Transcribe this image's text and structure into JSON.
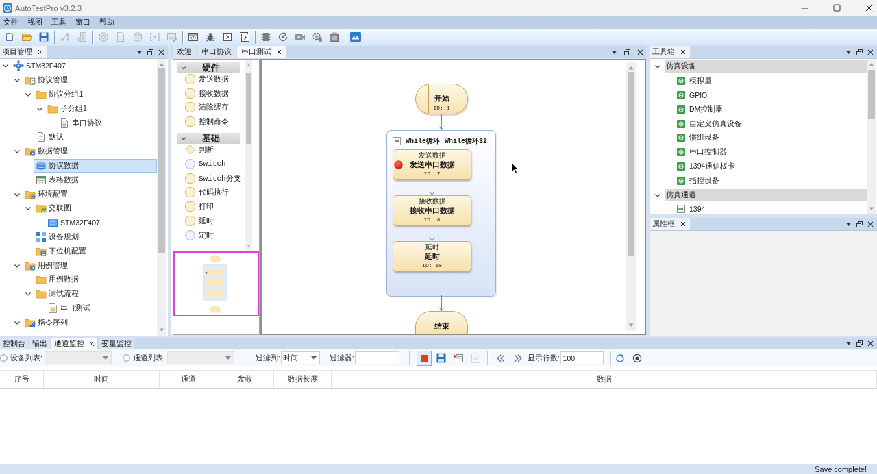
{
  "window": {
    "title": "AutoTestPro v3.2.3"
  },
  "menu": [
    "文件",
    "视图",
    "工具",
    "窗口",
    "帮助"
  ],
  "toolbar": [
    [
      {
        "disabled": false
      },
      {
        "disabled": false
      },
      {
        "disabled": false
      }
    ],
    [
      {
        "disabled": true
      },
      {
        "disabled": true
      }
    ],
    [
      {
        "disabled": true
      },
      {
        "disabled": true
      },
      {
        "disabled": true
      },
      {
        "disabled": true
      },
      {
        "disabled": true
      }
    ],
    [
      {
        "disabled": false
      },
      {
        "disabled": false
      },
      {
        "disabled": false
      },
      {
        "disabled": false
      }
    ],
    [
      {
        "disabled": false
      },
      {
        "disabled": false
      },
      {
        "disabled": false
      },
      {
        "disabled": false
      },
      {
        "disabled": false
      }
    ],
    [
      {
        "disabled": false
      }
    ]
  ],
  "project_panel": {
    "title": "项目管理",
    "tree": [
      {
        "label": "STM32F407",
        "kind": "project",
        "expanded": true,
        "selected": false,
        "children": [
          {
            "label": "协议管理",
            "kind": "group",
            "expanded": true,
            "selected": false,
            "children": [
              {
                "label": "协议分组1",
                "kind": "folder",
                "expanded": true,
                "selected": false,
                "children": [
                  {
                    "label": "子分组1",
                    "kind": "folder",
                    "expanded": true,
                    "selected": false,
                    "children": [
                      {
                        "label": "串口协议",
                        "kind": "file",
                        "selected": false
                      }
                    ]
                  }
                ]
              },
              {
                "label": "默认",
                "kind": "file",
                "selected": false
              }
            ]
          },
          {
            "label": "数据管理",
            "kind": "data",
            "expanded": true,
            "selected": false,
            "children": [
              {
                "label": "协议数据",
                "kind": "dataset",
                "selected": true
              },
              {
                "label": "表格数据",
                "kind": "table",
                "selected": false
              }
            ]
          },
          {
            "label": "环境配置",
            "kind": "config",
            "expanded": true,
            "selected": false,
            "children": [
              {
                "label": "交联图",
                "kind": "graph",
                "expanded": true,
                "selected": false,
                "children": [
                  {
                    "label": "STM32F407",
                    "kind": "board",
                    "selected": false
                  }
                ]
              },
              {
                "label": "设备规划",
                "kind": "layout",
                "selected": false
              },
              {
                "label": "下位机配置",
                "kind": "target",
                "selected": false
              }
            ]
          },
          {
            "label": "用例管理",
            "kind": "case",
            "expanded": true,
            "selected": false,
            "children": [
              {
                "label": "用例数据",
                "kind": "folder",
                "selected": false
              },
              {
                "label": "测试流程",
                "kind": "folder",
                "expanded": true,
                "selected": false,
                "children": [
                  {
                    "label": "串口测试",
                    "kind": "flow",
                    "selected": false
                  }
                ]
              }
            ]
          },
          {
            "label": "指令序列",
            "kind": "sequence",
            "expanded": true,
            "selected": false
          }
        ]
      }
    ]
  },
  "document": {
    "tabs": [
      {
        "label": "欢迎",
        "selected": false
      },
      {
        "label": "串口协议",
        "selected": false
      },
      {
        "label": "串口测试",
        "selected": true
      }
    ]
  },
  "palette": {
    "sections": [
      {
        "label": "硬件",
        "expanded": true,
        "items": [
          {
            "label": "发送数据",
            "kind": "task"
          },
          {
            "label": "接收数据",
            "kind": "task"
          },
          {
            "label": "清除缓存",
            "kind": "task"
          },
          {
            "label": "控制命令",
            "kind": "task"
          }
        ]
      },
      {
        "label": "基础",
        "expanded": true,
        "items": [
          {
            "label": "判断",
            "kind": "decision"
          },
          {
            "label": "Switch",
            "kind": "control"
          },
          {
            "label": "Switch分支",
            "kind": "task"
          },
          {
            "label": "代码执行",
            "kind": "task"
          },
          {
            "label": "打印",
            "kind": "task"
          },
          {
            "label": "延时",
            "kind": "task"
          },
          {
            "label": "定时",
            "kind": "control"
          }
        ]
      }
    ]
  },
  "flow": {
    "start": {
      "label": "开始",
      "id_label": "ID: 1"
    },
    "loop": {
      "type": "While循环",
      "name": "While循环32",
      "expanded": true,
      "steps": [
        {
          "category": "发送数据",
          "label": "发送串口数据",
          "id_label": "ID: 7",
          "breakpoint": true
        },
        {
          "category": "接收数据",
          "label": "接收串口数据",
          "id_label": "ID: 8",
          "breakpoint": false
        },
        {
          "category": "延时",
          "label": "延时",
          "id_label": "ID: 10",
          "breakpoint": false
        }
      ]
    },
    "end": {
      "label": "结束"
    }
  },
  "toolbox_panel": {
    "title": "工具箱",
    "groups": [
      {
        "label": "仿真设备",
        "expanded": true,
        "items": [
          {
            "label": "模拟量",
            "kind": "device"
          },
          {
            "label": "GPIO",
            "kind": "device"
          },
          {
            "label": "DM控制器",
            "kind": "device"
          },
          {
            "label": "自定义仿真设备",
            "kind": "device"
          },
          {
            "label": "惯组设备",
            "kind": "device"
          },
          {
            "label": "串口控制器",
            "kind": "device"
          },
          {
            "label": "1394通信板卡",
            "kind": "device"
          },
          {
            "label": "指控设备",
            "kind": "device"
          }
        ]
      },
      {
        "label": "仿真通道",
        "expanded": true,
        "items": [
          {
            "label": "1394",
            "kind": "channel"
          }
        ]
      }
    ]
  },
  "properties_panel": {
    "title": "属性框"
  },
  "monitor_panel": {
    "tabs": [
      {
        "label": "控制台",
        "selected": false
      },
      {
        "label": "输出",
        "selected": false
      },
      {
        "label": "通道监控",
        "selected": true
      },
      {
        "label": "变量监控",
        "selected": false
      }
    ],
    "toolbar": {
      "device_list": {
        "label": "设备列表:",
        "selected": false,
        "disabled": true
      },
      "channel_list": {
        "label": "通道列表:",
        "selected": false,
        "disabled": true
      },
      "filter_column": {
        "label": "过滤列:",
        "value": "时间"
      },
      "filter": {
        "label": "过滤器:"
      },
      "buttons": [
        {
          "pressed": true,
          "disabled": false
        },
        {
          "pressed": false,
          "disabled": false
        },
        {
          "pressed": false,
          "disabled": false
        },
        {
          "pressed": false,
          "disabled": true
        }
      ],
      "row_count": {
        "label": "显示行数:",
        "value": "100"
      }
    },
    "table": {
      "columns": [
        "序号",
        "时间",
        "通道",
        "发收",
        "数据长度",
        "数据"
      ]
    }
  },
  "status_bar": {
    "message": "Save complete!"
  }
}
